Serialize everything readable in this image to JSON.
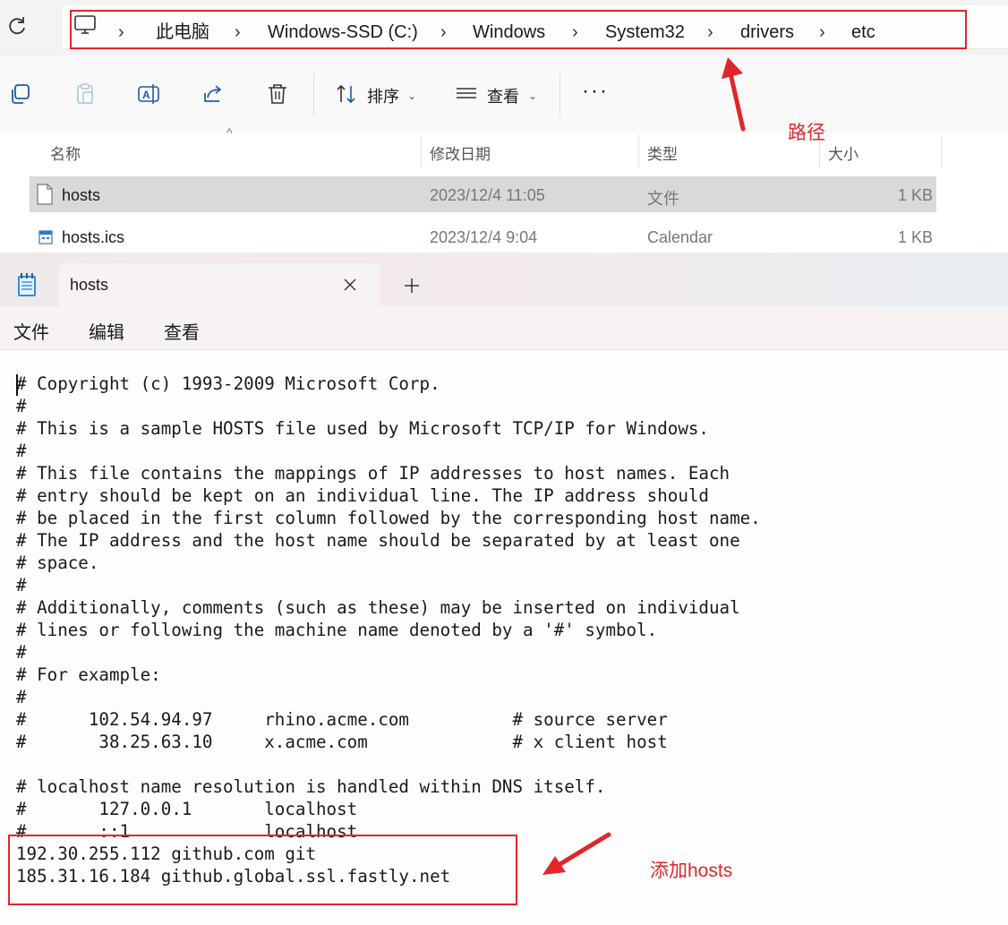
{
  "explorer": {
    "breadcrumbs": [
      "此电脑",
      "Windows-SSD (C:)",
      "Windows",
      "System32",
      "drivers",
      "etc"
    ],
    "toolbar": {
      "sort_label": "排序",
      "view_label": "查看"
    },
    "columns": {
      "name": "名称",
      "modified": "修改日期",
      "type": "类型",
      "size": "大小"
    },
    "files": [
      {
        "name": "hosts",
        "modified": "2023/12/4 11:05",
        "type": "文件",
        "size": "1 KB"
      },
      {
        "name": "hosts.ics",
        "modified": "2023/12/4 9:04",
        "type": "Calendar",
        "size": "1 KB"
      }
    ]
  },
  "annotations": {
    "path_label": "路径",
    "hosts_label": "添加hosts",
    "color": "#e0262c"
  },
  "notepad": {
    "tab_title": "hosts",
    "menu": [
      "文件",
      "编辑",
      "查看"
    ],
    "content_lines": [
      "# Copyright (c) 1993-2009 Microsoft Corp.",
      "#",
      "# This is a sample HOSTS file used by Microsoft TCP/IP for Windows.",
      "#",
      "# This file contains the mappings of IP addresses to host names. Each",
      "# entry should be kept on an individual line. The IP address should",
      "# be placed in the first column followed by the corresponding host name.",
      "# The IP address and the host name should be separated by at least one",
      "# space.",
      "#",
      "# Additionally, comments (such as these) may be inserted on individual",
      "# lines or following the machine name denoted by a '#' symbol.",
      "#",
      "# For example:",
      "#",
      "#      102.54.94.97     rhino.acme.com          # source server",
      "#       38.25.63.10     x.acme.com              # x client host",
      "",
      "# localhost name resolution is handled within DNS itself.",
      "#       127.0.0.1       localhost",
      "#       ::1             localhost",
      "192.30.255.112 github.com git",
      "185.31.16.184 github.global.ssl.fastly.net"
    ]
  }
}
